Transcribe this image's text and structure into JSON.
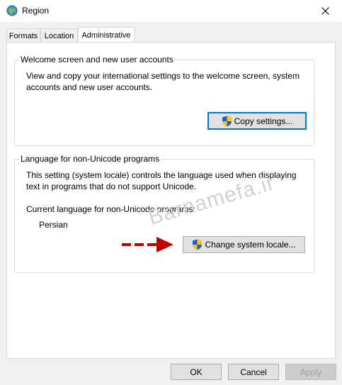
{
  "window": {
    "title": "Region"
  },
  "tabs": [
    {
      "label": "Formats"
    },
    {
      "label": "Location"
    },
    {
      "label": "Administrative"
    }
  ],
  "welcome_group": {
    "legend": "Welcome screen and new user accounts",
    "line1": "View and copy your international settings to the welcome screen, system",
    "line2": "accounts and new user accounts.",
    "button_label": "Copy settings..."
  },
  "unicode_group": {
    "legend": "Language for non-Unicode programs",
    "line1": "This setting (system locale) controls the language used when displaying",
    "line2": "text in programs that do not support Unicode.",
    "current_label": "Current language for non-Unicode programs:",
    "current_value": "Persian",
    "button_label": "Change system locale..."
  },
  "watermark": "Barnamefa.ir",
  "footer": {
    "ok_label": "OK",
    "cancel_label": "Cancel",
    "apply_label": "Apply"
  },
  "colors": {
    "focus_border": "#0078d7",
    "arrow": "#c00000"
  }
}
